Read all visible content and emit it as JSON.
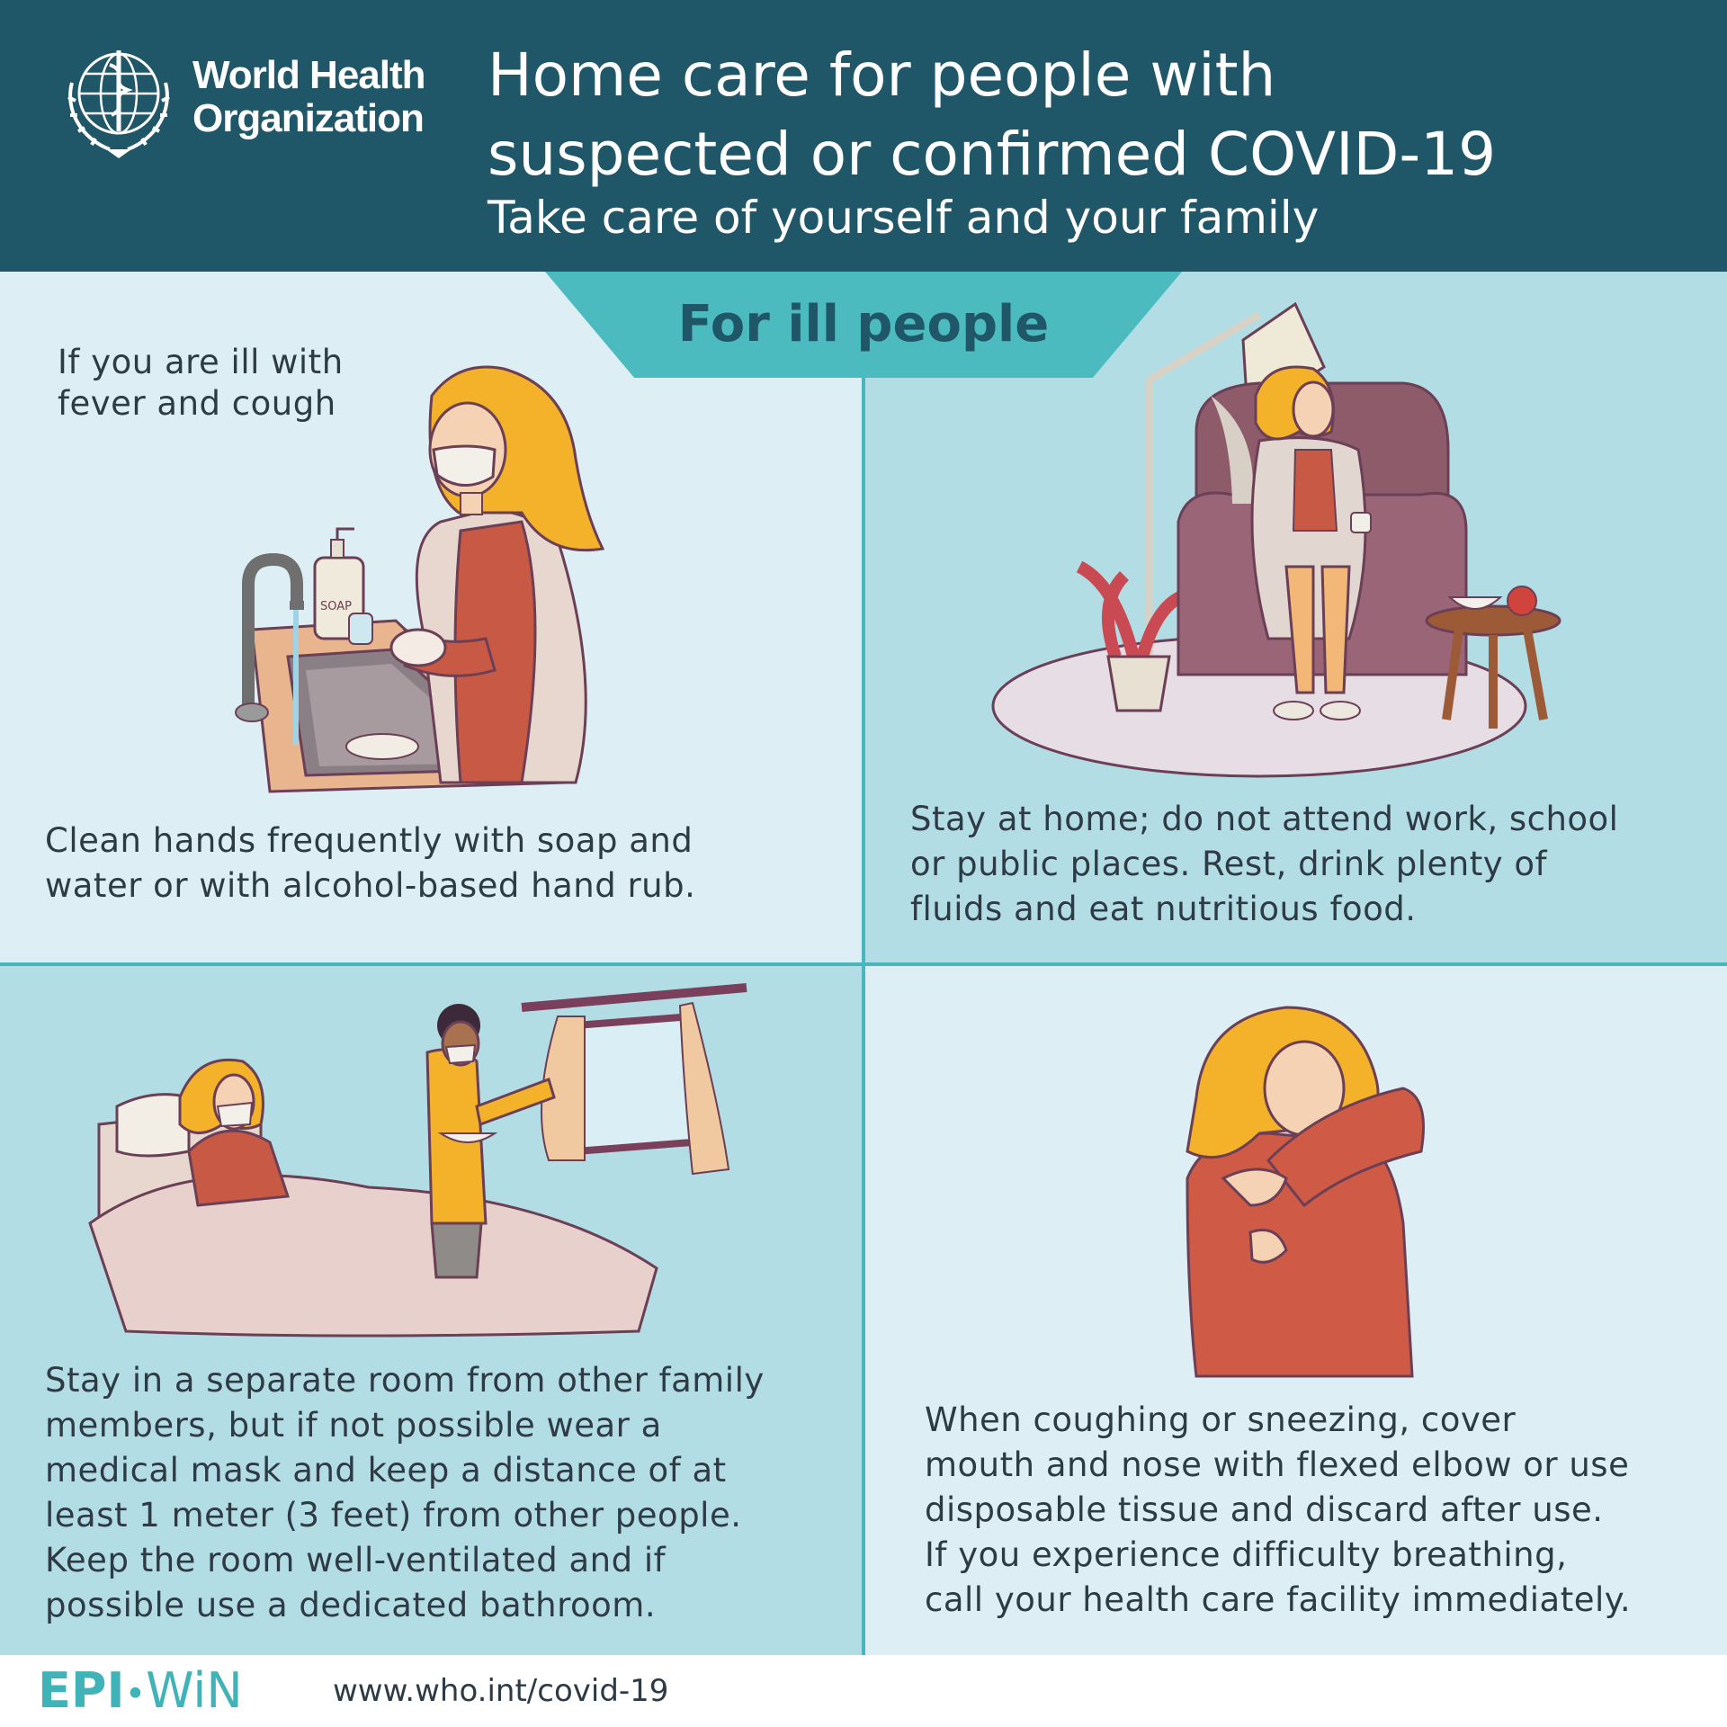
{
  "header": {
    "org_line1": "World Health",
    "org_line2": "Organization",
    "title_line1": "Home care for people with",
    "title_line2": "suspected or confirmed COVID-19",
    "subtitle": "Take care of yourself and your family"
  },
  "banner": {
    "label": "For ill people"
  },
  "panels": [
    {
      "intro_lines": [
        "If you are ill with",
        "fever and cough"
      ],
      "lines": [
        "Clean hands frequently with soap and",
        "water or with alcohol-based hand rub."
      ],
      "soap_label": "SOAP"
    },
    {
      "lines": [
        "Stay at home; do not attend work, school",
        "or public places. Rest, drink plenty of",
        "fluids and eat nutritious food."
      ]
    },
    {
      "lines": [
        "Stay in a separate room from other family",
        "members, but if not possible wear a",
        "medical mask and keep a distance of at",
        "least 1 meter (3 feet) from other people.",
        "Keep the room well-ventilated and if",
        "possible use a dedicated bathroom."
      ]
    },
    {
      "lines": [
        "When coughing or sneezing, cover",
        "mouth and nose with flexed elbow or use",
        "disposable tissue and discard after use.",
        "If you experience difficulty breathing,",
        "call your health care facility immediately."
      ]
    }
  ],
  "footer": {
    "brand_left": "EPI",
    "brand_dot": "•",
    "brand_right": "WiN",
    "url": "www.who.int/covid-19"
  },
  "colors": {
    "header_bg": "#1f5769",
    "banner": "#4cbbc0",
    "panel_light": "#ddeff4",
    "panel_dark": "#b3dde5",
    "hair": "#f4b22a",
    "shirt": "#cf5a45"
  }
}
